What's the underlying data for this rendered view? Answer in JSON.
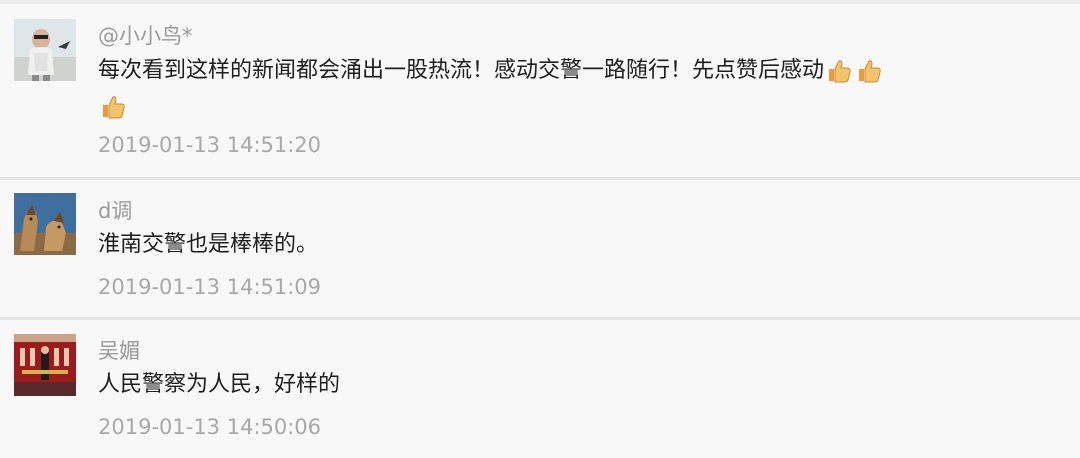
{
  "comments": [
    {
      "username": "@小小鸟*",
      "text": "每次看到这样的新闻都会涌出一股热流！感动交警一路随行！先点赞后感动",
      "emojis": [
        "thumbs-up-icon",
        "thumbs-up-icon",
        "thumbs-up-icon"
      ],
      "timestamp": "2019-01-13 14:51:20",
      "avatar": "avatar-child-photo"
    },
    {
      "username": "d调",
      "text": "淮南交警也是棒棒的。",
      "emojis": [],
      "timestamp": "2019-01-13 14:51:09",
      "avatar": "avatar-dogs-photo"
    },
    {
      "username": "吴媚",
      "text": "人民警察为人民，好样的",
      "emojis": [],
      "timestamp": "2019-01-13 14:50:06",
      "avatar": "avatar-stage-photo"
    }
  ],
  "colors": {
    "background": "#f8f8f8",
    "divider": "#e6e6e6",
    "username": "#9a9a9a",
    "text": "#1e1e1e",
    "timestamp": "#a8a8a8"
  }
}
